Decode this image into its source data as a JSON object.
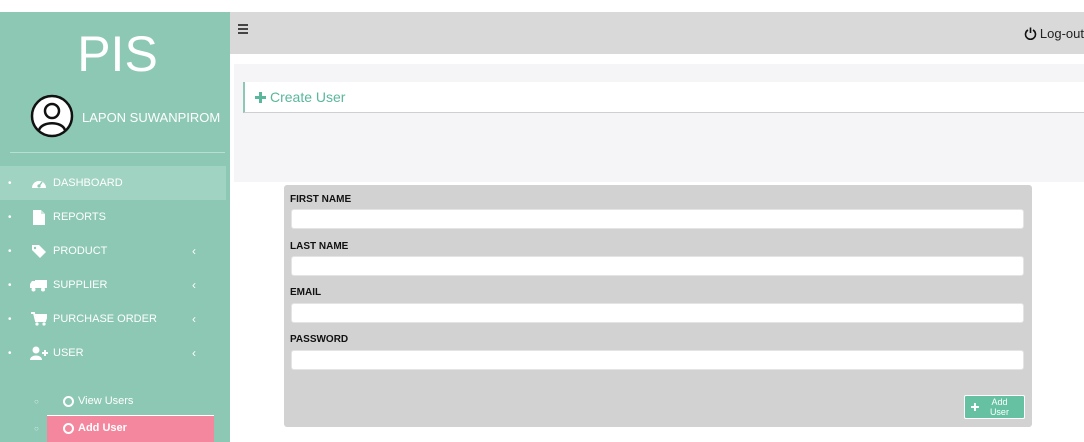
{
  "sidebar": {
    "brand": "PIS",
    "user_name": "LAPON SUWANPIROM",
    "menu": [
      {
        "label": "DASHBOARD",
        "icon": "dashboard-icon",
        "arrow": ""
      },
      {
        "label": "REPORTS",
        "icon": "file-icon",
        "arrow": ""
      },
      {
        "label": "PRODUCT",
        "icon": "tag-icon",
        "arrow": "‹"
      },
      {
        "label": "SUPPLIER",
        "icon": "truck-icon",
        "arrow": "‹"
      },
      {
        "label": "PURCHASE ORDER",
        "icon": "cart-icon",
        "arrow": "‹"
      },
      {
        "label": "USER",
        "icon": "user-add-icon",
        "arrow": "‹"
      }
    ],
    "submenu": [
      {
        "label": "View Users",
        "active": false
      },
      {
        "label": "Add User",
        "active": true
      }
    ],
    "bullet": "•",
    "sub_bullet": "○"
  },
  "topbar": {
    "logout_label": "Log-out"
  },
  "page": {
    "title": "Create User"
  },
  "form": {
    "fields": [
      {
        "label": "FIRST NAME",
        "value": ""
      },
      {
        "label": "LAST NAME",
        "value": ""
      },
      {
        "label": "EMAIL",
        "value": ""
      },
      {
        "label": "PASSWORD",
        "value": ""
      }
    ],
    "submit_label": "Add User"
  },
  "colors": {
    "sidebar_bg": "#8cc8b4",
    "active_item": "#f4879d",
    "accent": "#5ab79c",
    "button": "#66c1a2",
    "topbar": "#d9d9d9",
    "form_card": "#d2d2d2"
  }
}
